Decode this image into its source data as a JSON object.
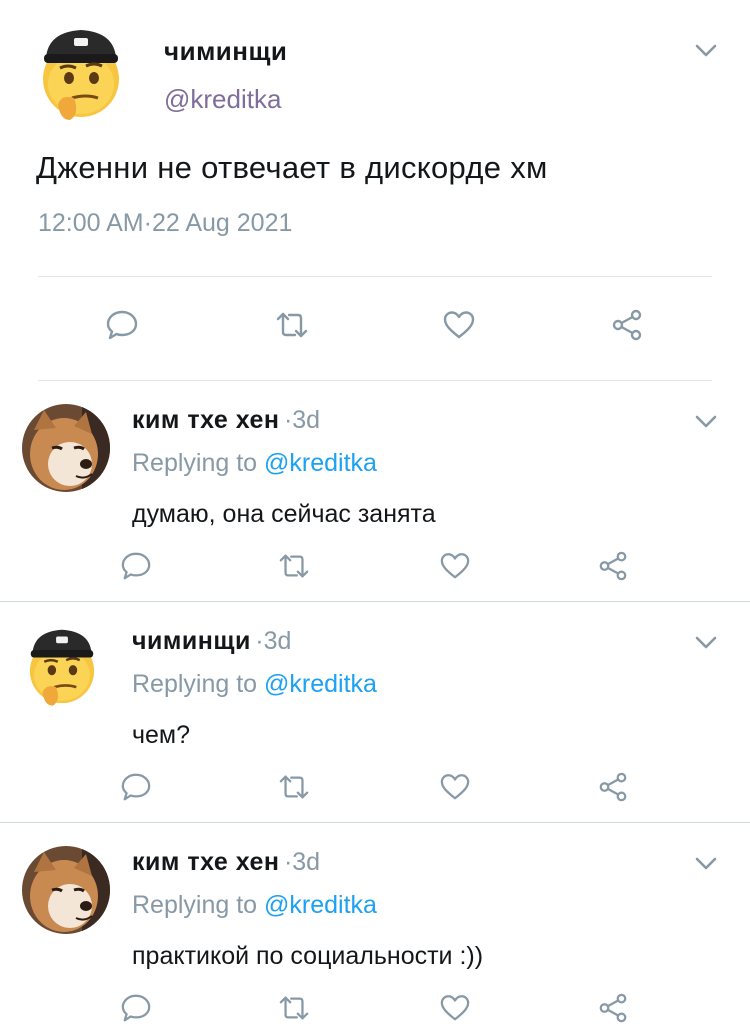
{
  "main_tweet": {
    "display_name": "чиминщи",
    "handle": "@kreditka",
    "text": "Дженни не отвечает в дискорде хм",
    "time": "12:00 AM",
    "date": "22 Aug 2021",
    "avatar_icon": "thinking-face-cap-emoji"
  },
  "replies": [
    {
      "display_name": "ким тхе хен",
      "age": "3d",
      "replying_prefix": "Replying to",
      "replying_handle": "@kreditka",
      "text": "думаю, она сейчас занята",
      "avatar_icon": "shiba-dog-photo"
    },
    {
      "display_name": "чиминщи",
      "age": "3d",
      "replying_prefix": "Replying to",
      "replying_handle": "@kreditka",
      "text": "чем?",
      "avatar_icon": "thinking-face-cap-emoji"
    },
    {
      "display_name": "ким тхе хен",
      "age": "3d",
      "replying_prefix": "Replying to",
      "replying_handle": "@kreditka",
      "text": "практикой по социальности :))",
      "avatar_icon": "shiba-dog-photo"
    }
  ],
  "colors": {
    "handle_main": "#7f6e9c",
    "link": "#1da1f2",
    "muted": "#8899a6",
    "divider": "#e1e8ed"
  }
}
